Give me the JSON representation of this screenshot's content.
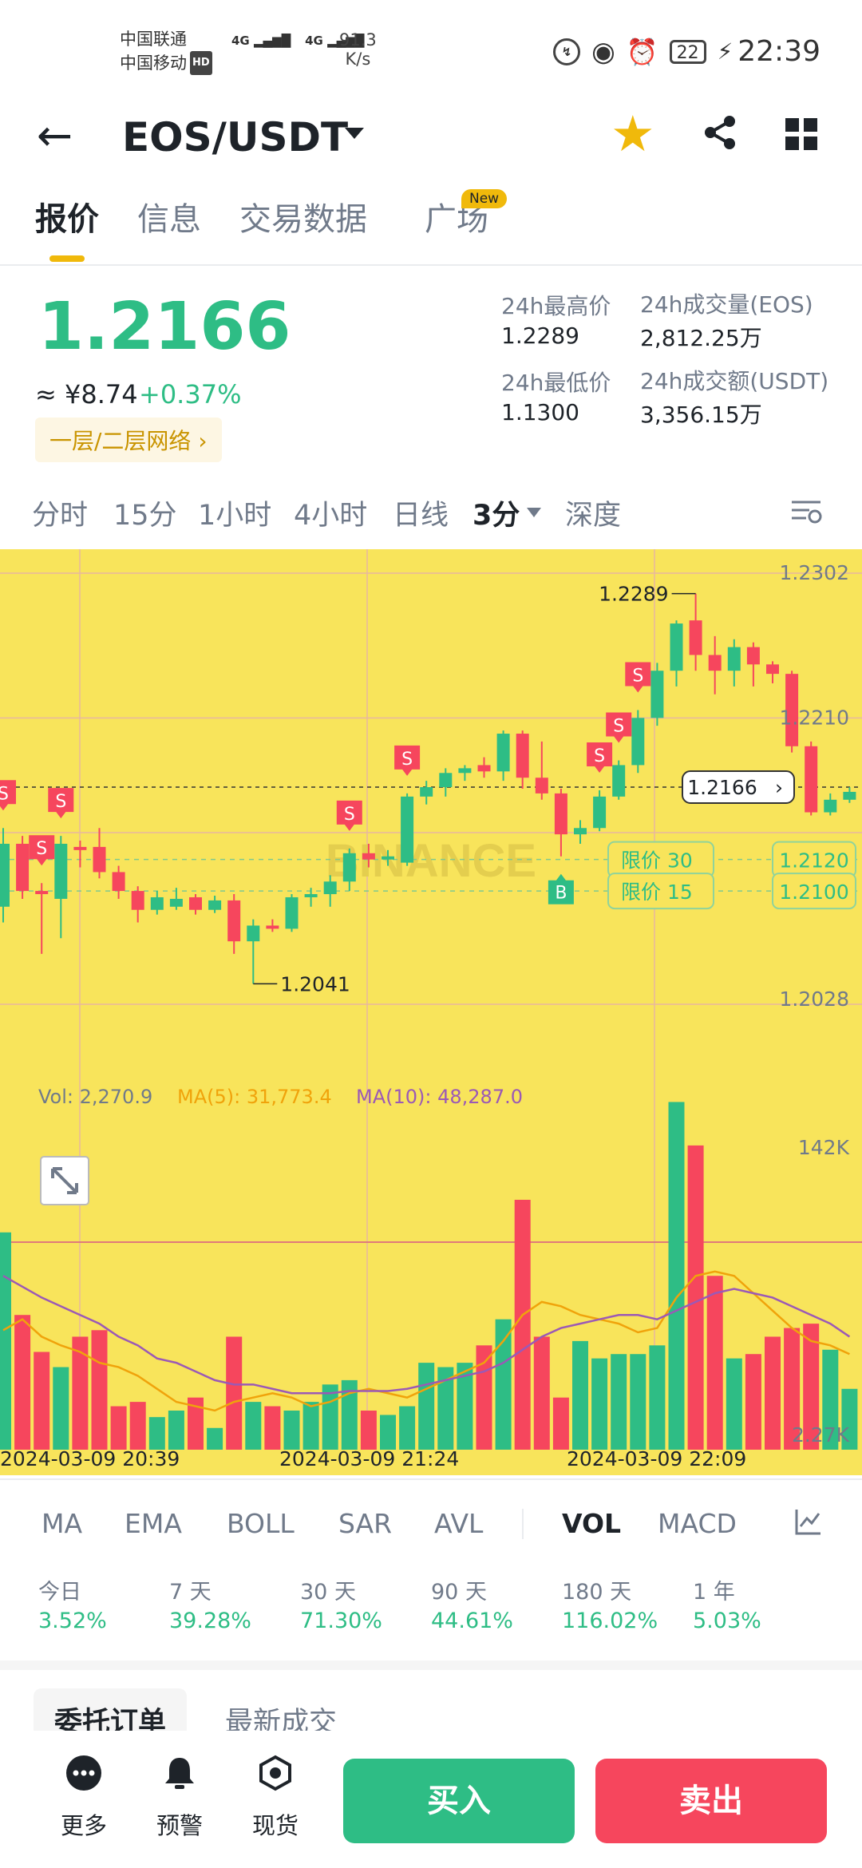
{
  "status_bar": {
    "carrier1": "中国联通",
    "carrier2": "中国移动",
    "hd": "HD",
    "net1": "4G",
    "net2": "4G",
    "speed_value": "91.3",
    "speed_unit": "K/s",
    "battery": "22",
    "time": "22:39"
  },
  "header": {
    "title": "EOS/USDT",
    "favorite_color": "#f0b90b"
  },
  "tabs": [
    {
      "label": "报价",
      "active": true
    },
    {
      "label": "信息",
      "active": false
    },
    {
      "label": "交易数据",
      "active": false
    },
    {
      "label": "广场",
      "active": false
    }
  ],
  "new_badge": "New",
  "price": {
    "last": "1.2166",
    "cny": "≈ ¥8.74",
    "change": "+0.37%",
    "network": "一层/二层网络",
    "stats": [
      {
        "label": "24h最高价",
        "value": "1.2289"
      },
      {
        "label": "24h成交量(EOS)",
        "value": "2,812.25万"
      },
      {
        "label": "24h最低价",
        "value": "1.1300"
      },
      {
        "label": "24h成交额(USDT)",
        "value": "3,356.15万"
      }
    ]
  },
  "intervals": [
    {
      "label": "分时",
      "active": false
    },
    {
      "label": "15分",
      "active": false
    },
    {
      "label": "1小时",
      "active": false
    },
    {
      "label": "4小时",
      "active": false
    },
    {
      "label": "日线",
      "active": false
    },
    {
      "label": "3分",
      "active": true
    },
    {
      "label": "深度",
      "active": false
    }
  ],
  "chart_data": {
    "type": "candlestick",
    "symbol": "EOS/USDT",
    "interval": "3分",
    "watermark": "BINANCE",
    "price_axis_labels": [
      "1.2302",
      "1.2210",
      "1.2028"
    ],
    "ylim": [
      1.2028,
      1.2302
    ],
    "high_label": "1.2289",
    "low_label": "1.2041",
    "current_price": "1.2166",
    "order_lines": [
      {
        "label": "限价",
        "qty": "30",
        "price": "1.2120"
      },
      {
        "label": "限价",
        "qty": "15",
        "price": "1.2100"
      }
    ],
    "trade_markers": {
      "sell": "S",
      "buy": "B"
    },
    "candles": [
      [
        1.209,
        1.213,
        1.208,
        1.214
      ],
      [
        1.213,
        1.21,
        1.2095,
        1.2135
      ],
      [
        1.21,
        1.2098,
        1.206,
        1.2105
      ],
      [
        1.2095,
        1.213,
        1.207,
        1.2135
      ],
      [
        1.2128,
        1.2126,
        1.2115,
        1.2132
      ],
      [
        1.2128,
        1.2112,
        1.2108,
        1.214
      ],
      [
        1.2112,
        1.21,
        1.2095,
        1.2116
      ],
      [
        1.21,
        1.2088,
        1.208,
        1.2103
      ],
      [
        1.2088,
        1.2096,
        1.2085,
        1.21
      ],
      [
        1.209,
        1.2095,
        1.2088,
        1.2102
      ],
      [
        1.2096,
        1.2088,
        1.2085,
        1.2098
      ],
      [
        1.2088,
        1.2094,
        1.2086,
        1.2097
      ],
      [
        1.2094,
        1.2068,
        1.206,
        1.2098
      ],
      [
        1.2068,
        1.2078,
        1.2041,
        1.2082
      ],
      [
        1.2078,
        1.2076,
        1.2074,
        1.2082
      ],
      [
        1.2076,
        1.2096,
        1.2074,
        1.2098
      ],
      [
        1.2096,
        1.2098,
        1.209,
        1.2102
      ],
      [
        1.2098,
        1.2106,
        1.209,
        1.211
      ],
      [
        1.2106,
        1.2124,
        1.21,
        1.2127
      ],
      [
        1.2124,
        1.212,
        1.2115,
        1.213
      ],
      [
        1.212,
        1.2122,
        1.2116,
        1.2126
      ],
      [
        1.2118,
        1.216,
        1.2116,
        1.2162
      ],
      [
        1.216,
        1.2166,
        1.2155,
        1.217
      ],
      [
        1.2166,
        1.2175,
        1.216,
        1.2178
      ],
      [
        1.2175,
        1.2178,
        1.217,
        1.218
      ],
      [
        1.218,
        1.2176,
        1.2172,
        1.2185
      ],
      [
        1.2176,
        1.22,
        1.217,
        1.2202
      ],
      [
        1.22,
        1.2172,
        1.2165,
        1.2202
      ],
      [
        1.2172,
        1.2162,
        1.2158,
        1.2195
      ],
      [
        1.2162,
        1.2136,
        1.2122,
        1.2165
      ],
      [
        1.2136,
        1.214,
        1.213,
        1.2145
      ],
      [
        1.214,
        1.216,
        1.2138,
        1.2164
      ],
      [
        1.216,
        1.218,
        1.2158,
        1.2183
      ],
      [
        1.218,
        1.221,
        1.2175,
        1.2215
      ],
      [
        1.221,
        1.224,
        1.2205,
        1.2245
      ],
      [
        1.224,
        1.227,
        1.223,
        1.2272
      ],
      [
        1.2272,
        1.225,
        1.224,
        1.2289
      ],
      [
        1.225,
        1.224,
        1.2225,
        1.2262
      ],
      [
        1.224,
        1.2255,
        1.223,
        1.226
      ],
      [
        1.2255,
        1.2244,
        1.223,
        1.2258
      ],
      [
        1.2244,
        1.2238,
        1.2232,
        1.2246
      ],
      [
        1.2238,
        1.2192,
        1.2188,
        1.224
      ],
      [
        1.2192,
        1.215,
        1.2148,
        1.2195
      ],
      [
        1.215,
        1.2158,
        1.2148,
        1.2162
      ],
      [
        1.2158,
        1.2163,
        1.2156,
        1.2166
      ]
    ],
    "volume": {
      "vol_label": "Vol: 2,270.9",
      "ma5_label": "MA(5): 31,773.4",
      "ma10_label": "MA(10): 48,287.0",
      "axis_max_label": "142K",
      "axis_min_label": "2.27K",
      "bars": [
        100,
        62,
        45,
        38,
        52,
        55,
        20,
        22,
        15,
        18,
        24,
        10,
        52,
        22,
        20,
        18,
        22,
        30,
        32,
        18,
        16,
        20,
        40,
        38,
        40,
        48,
        60,
        115,
        52,
        24,
        50,
        42,
        44,
        44,
        48,
        160,
        140,
        80,
        42,
        44,
        52,
        56,
        58,
        46,
        28
      ],
      "ma5": [
        55,
        60,
        52,
        48,
        45,
        40,
        38,
        34,
        28,
        22,
        20,
        18,
        22,
        24,
        26,
        24,
        20,
        22,
        26,
        28,
        26,
        24,
        28,
        32,
        36,
        40,
        50,
        62,
        68,
        66,
        62,
        60,
        58,
        54,
        56,
        70,
        80,
        82,
        80,
        72,
        64,
        56,
        50,
        48,
        44
      ],
      "ma10": [
        80,
        75,
        70,
        66,
        62,
        58,
        52,
        48,
        42,
        40,
        36,
        32,
        30,
        30,
        28,
        26,
        26,
        26,
        27,
        27,
        27,
        28,
        30,
        32,
        34,
        36,
        40,
        46,
        52,
        56,
        58,
        60,
        62,
        62,
        60,
        64,
        68,
        72,
        74,
        72,
        70,
        66,
        62,
        58,
        52
      ]
    },
    "time_labels": [
      "2024-03-09 20:39",
      "2024-03-09 21:24",
      "2024-03-09 22:09"
    ]
  },
  "indicators": [
    {
      "label": "MA",
      "active": false
    },
    {
      "label": "EMA",
      "active": false
    },
    {
      "label": "BOLL",
      "active": false
    },
    {
      "label": "SAR",
      "active": false
    },
    {
      "label": "AVL",
      "active": false
    },
    {
      "label": "VOL",
      "active": true
    },
    {
      "label": "MACD",
      "active": false
    }
  ],
  "performance": [
    {
      "label": "今日",
      "value": "3.52%"
    },
    {
      "label": "7 天",
      "value": "39.28%"
    },
    {
      "label": "30 天",
      "value": "71.30%"
    },
    {
      "label": "90 天",
      "value": "44.61%"
    },
    {
      "label": "180 天",
      "value": "116.02%"
    },
    {
      "label": "1 年",
      "value": "5.03%"
    }
  ],
  "order_tabs": {
    "orders": "委托订单",
    "trades": "最新成交"
  },
  "bottom_bar": {
    "more": "更多",
    "alert": "预警",
    "spot": "现货",
    "buy": "买入",
    "sell": "卖出",
    "buy_color": "#2ebd85",
    "sell_color": "#f6465d"
  }
}
